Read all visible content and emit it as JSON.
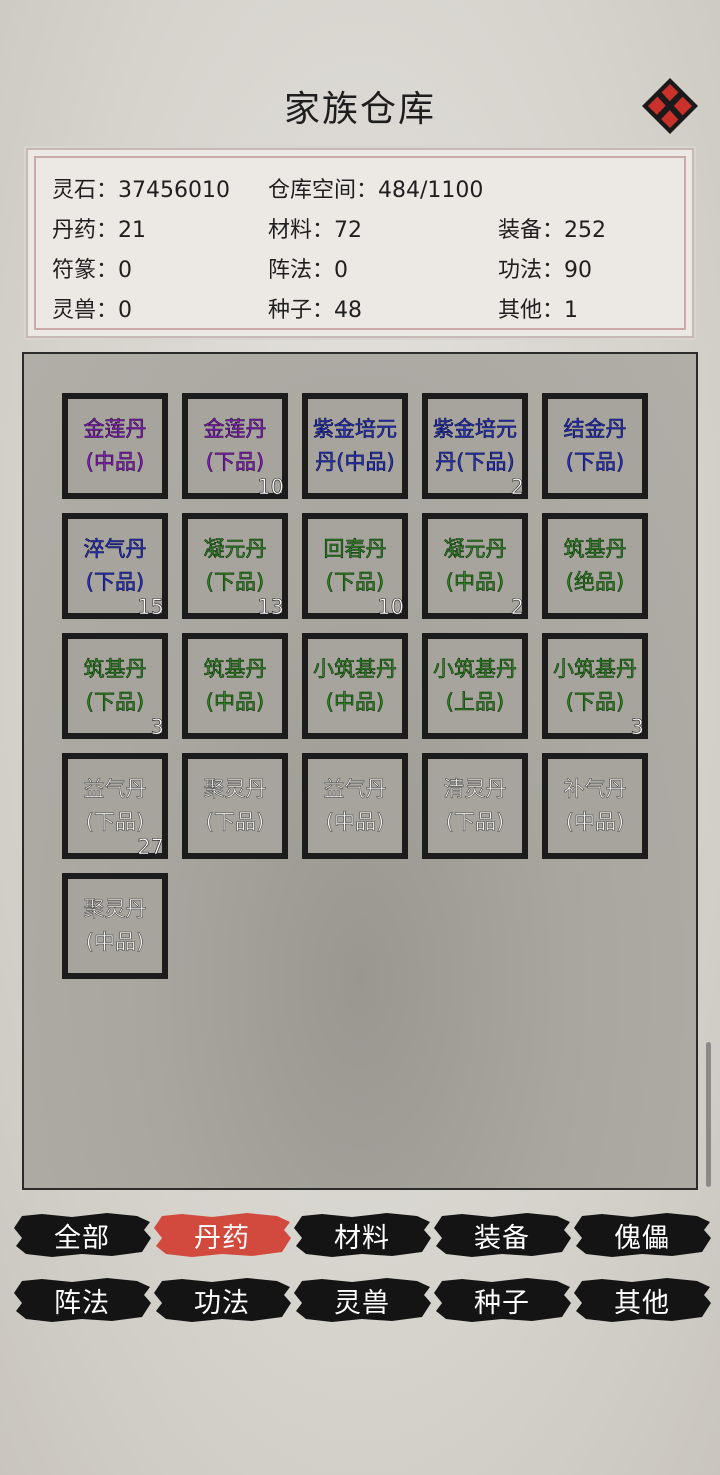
{
  "header": {
    "title": "家族仓库"
  },
  "stats": {
    "spirit_stone": "灵石：37456010",
    "capacity": "仓库空间：484/1100",
    "pills": "丹药：21",
    "materials": "材料：72",
    "equipment": "装备：252",
    "talismans": "符篆：0",
    "formations": "阵法：0",
    "techniques": "功法：90",
    "beasts": "灵兽：0",
    "seeds": "种子：48",
    "others": "其他：1"
  },
  "items": [
    {
      "line1": "金莲丹",
      "line2": "(中品)",
      "count": "",
      "quality": "purple"
    },
    {
      "line1": "金莲丹",
      "line2": "(下品)",
      "count": "10",
      "quality": "purple"
    },
    {
      "line1": "紫金培元",
      "line2": "丹(中品)",
      "count": "",
      "quality": "blue"
    },
    {
      "line1": "紫金培元",
      "line2": "丹(下品)",
      "count": "2",
      "quality": "blue"
    },
    {
      "line1": "结金丹",
      "line2": "(下品)",
      "count": "",
      "quality": "blue"
    },
    {
      "line1": "淬气丹",
      "line2": "(下品)",
      "count": "15",
      "quality": "blue"
    },
    {
      "line1": "凝元丹",
      "line2": "(下品)",
      "count": "13",
      "quality": "green"
    },
    {
      "line1": "回春丹",
      "line2": "(下品)",
      "count": "10",
      "quality": "green"
    },
    {
      "line1": "凝元丹",
      "line2": "(中品)",
      "count": "2",
      "quality": "green"
    },
    {
      "line1": "筑基丹",
      "line2": "(绝品)",
      "count": "",
      "quality": "green"
    },
    {
      "line1": "筑基丹",
      "line2": "(下品)",
      "count": "3",
      "quality": "green"
    },
    {
      "line1": "筑基丹",
      "line2": "(中品)",
      "count": "",
      "quality": "green"
    },
    {
      "line1": "小筑基丹",
      "line2": "(中品)",
      "count": "",
      "quality": "green"
    },
    {
      "line1": "小筑基丹",
      "line2": "(上品)",
      "count": "",
      "quality": "green"
    },
    {
      "line1": "小筑基丹",
      "line2": "(下品)",
      "count": "3",
      "quality": "green"
    },
    {
      "line1": "益气丹",
      "line2": "(下品)",
      "count": "27",
      "quality": "white"
    },
    {
      "line1": "聚灵丹",
      "line2": "(下品)",
      "count": "",
      "quality": "white"
    },
    {
      "line1": "益气丹",
      "line2": "(中品)",
      "count": "",
      "quality": "white"
    },
    {
      "line1": "清灵丹",
      "line2": "(下品)",
      "count": "",
      "quality": "white"
    },
    {
      "line1": "补气丹",
      "line2": "(中品)",
      "count": "",
      "quality": "white"
    },
    {
      "line1": "聚灵丹",
      "line2": "(中品)",
      "count": "",
      "quality": "white"
    }
  ],
  "tabs": [
    {
      "label": "全部",
      "active": false
    },
    {
      "label": "丹药",
      "active": true
    },
    {
      "label": "材料",
      "active": false
    },
    {
      "label": "装备",
      "active": false
    },
    {
      "label": "傀儡",
      "active": false
    },
    {
      "label": "阵法",
      "active": false
    },
    {
      "label": "功法",
      "active": false
    },
    {
      "label": "灵兽",
      "active": false
    },
    {
      "label": "种子",
      "active": false
    },
    {
      "label": "其他",
      "active": false
    }
  ],
  "colors": {
    "active_tab": "#d24a3e",
    "inactive_tab": "#141414",
    "close_button": "#c8322a"
  }
}
